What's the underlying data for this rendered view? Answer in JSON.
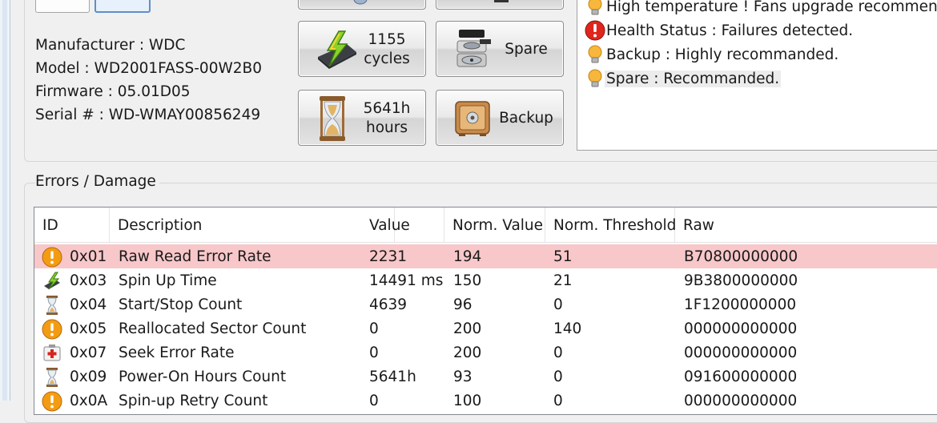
{
  "drive": {
    "manufacturer": "Manufacturer : WDC",
    "model": "Model : WD2001FASS-00W2B0",
    "firmware": "Firmware : 05.01D05",
    "serial": "Serial # : WD-WMAY00856249"
  },
  "buttons": {
    "cycles_value": "1155",
    "cycles_unit": "cycles",
    "hours_value": "5641h",
    "hours_unit": "hours",
    "spare": "Spare",
    "backup": "Backup"
  },
  "events": [
    {
      "icon": "bulb-icon",
      "text": "High temperature ! Fans upgrade recommended"
    },
    {
      "icon": "error-icon",
      "text": "Health Status : Failures detected."
    },
    {
      "icon": "bulb-icon",
      "text": "Backup : Highly recommanded."
    },
    {
      "icon": "bulb-icon",
      "text": "Spare : Recommanded."
    }
  ],
  "errors_group": "Errors / Damage",
  "table": {
    "columns": [
      "ID",
      "Description",
      "Value",
      "Norm. Value",
      "Norm. Threshold",
      "Raw"
    ],
    "rows": [
      {
        "icon": "warning-icon",
        "id": "0x01",
        "desc": "Raw Read Error Rate",
        "value": "2231",
        "norm": "194",
        "thr": "51",
        "raw": "B70800000000",
        "highlight": true
      },
      {
        "icon": "spin-icon",
        "id": "0x03",
        "desc": "Spin Up Time",
        "value": "14491 ms",
        "norm": "150",
        "thr": "21",
        "raw": "9B3800000000",
        "highlight": false
      },
      {
        "icon": "hourglass-icon",
        "id": "0x04",
        "desc": "Start/Stop Count",
        "value": "4639",
        "norm": "96",
        "thr": "0",
        "raw": "1F1200000000",
        "highlight": false
      },
      {
        "icon": "warning-icon",
        "id": "0x05",
        "desc": "Reallocated Sector Count",
        "value": "0",
        "norm": "200",
        "thr": "140",
        "raw": "000000000000",
        "highlight": false
      },
      {
        "icon": "medkit-icon",
        "id": "0x07",
        "desc": "Seek Error Rate",
        "value": "0",
        "norm": "200",
        "thr": "0",
        "raw": "000000000000",
        "highlight": false
      },
      {
        "icon": "hourglass-icon",
        "id": "0x09",
        "desc": "Power-On Hours Count",
        "value": "5641h",
        "norm": "93",
        "thr": "0",
        "raw": "091600000000",
        "highlight": false
      },
      {
        "icon": "warning-icon",
        "id": "0x0A",
        "desc": "Spin-up Retry Count",
        "value": "0",
        "norm": "100",
        "thr": "0",
        "raw": "000000000000",
        "highlight": false
      }
    ]
  },
  "colors": {
    "highlight_row": "#f8c7c9",
    "warning": "#f39c12",
    "error": "#d9241c"
  }
}
